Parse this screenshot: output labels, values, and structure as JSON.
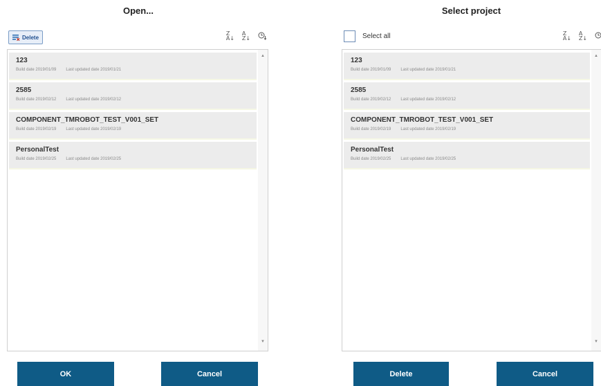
{
  "left_panel": {
    "title": "Open...",
    "delete_label": "Delete",
    "sort_icons": [
      "sort-za-icon",
      "sort-az-icon",
      "sort-time-icon"
    ],
    "items": [
      {
        "name": "123",
        "build_label": "Build date",
        "build_date": "2019/01/09",
        "updated_label": "Last updated date",
        "updated_date": "2019/01/21"
      },
      {
        "name": "2585",
        "build_label": "Build date",
        "build_date": "2019/02/12",
        "updated_label": "Last updated date",
        "updated_date": "2019/02/12"
      },
      {
        "name": "COMPONENT_TMROBOT_TEST_V001_SET",
        "build_label": "Build date",
        "build_date": "2019/02/19",
        "updated_label": "Last updated date",
        "updated_date": "2019/02/19"
      },
      {
        "name": "PersonalTest",
        "build_label": "Build date",
        "build_date": "2019/02/25",
        "updated_label": "Last updated date",
        "updated_date": "2019/02/25"
      }
    ],
    "ok_label": "OK",
    "cancel_label": "Cancel"
  },
  "right_panel": {
    "title": "Select project",
    "select_all_label": "Select all",
    "select_all_checked": false,
    "items": [
      {
        "name": "123",
        "build_label": "Build date",
        "build_date": "2019/01/09",
        "updated_label": "Last updated date",
        "updated_date": "2019/01/21"
      },
      {
        "name": "2585",
        "build_label": "Build date",
        "build_date": "2019/02/12",
        "updated_label": "Last updated date",
        "updated_date": "2019/02/12"
      },
      {
        "name": "COMPONENT_TMROBOT_TEST_V001_SET",
        "build_label": "Build date",
        "build_date": "2019/02/19",
        "updated_label": "Last updated date",
        "updated_date": "2019/02/19"
      },
      {
        "name": "PersonalTest",
        "build_label": "Build date",
        "build_date": "2019/02/25",
        "updated_label": "Last updated date",
        "updated_date": "2019/02/25"
      }
    ],
    "delete_label": "Delete",
    "cancel_label": "Cancel"
  },
  "colors": {
    "button_bg": "#0f5b86",
    "item_bg": "#ececec",
    "chip_border": "#7a9cc6"
  }
}
